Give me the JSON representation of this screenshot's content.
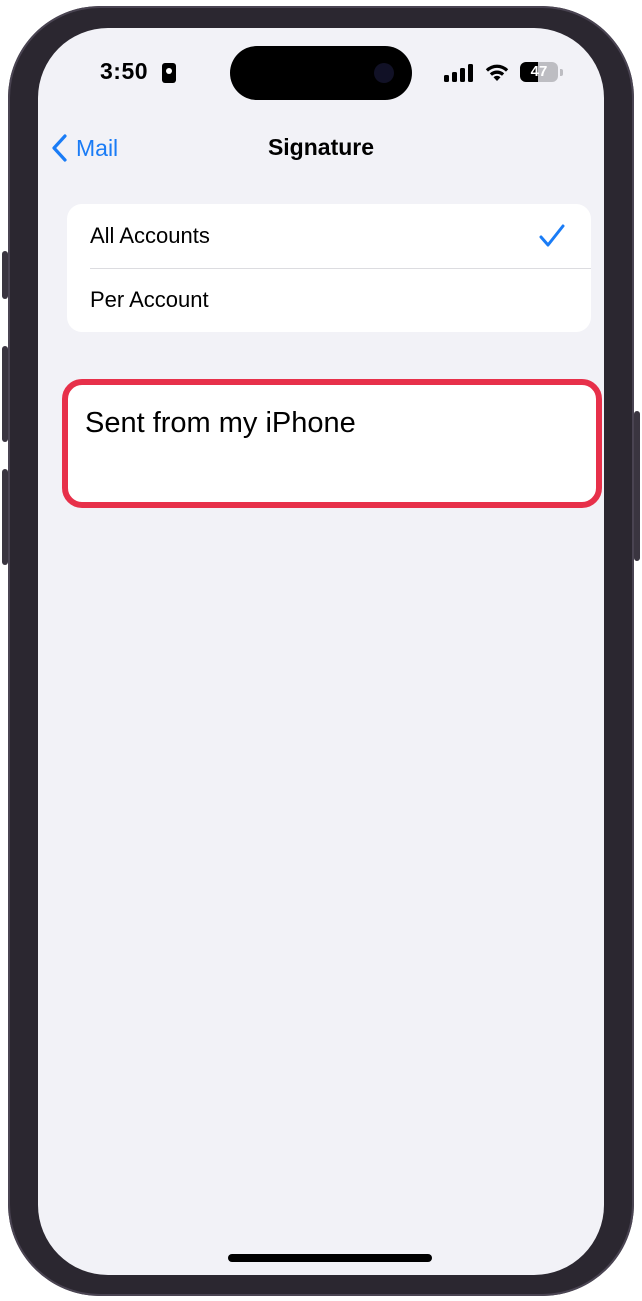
{
  "status_bar": {
    "time": "3:50",
    "battery_level": "47",
    "icons": [
      "id-card-icon",
      "cellular-signal-icon",
      "wifi-icon",
      "battery-icon"
    ]
  },
  "nav": {
    "back_label": "Mail",
    "title": "Signature"
  },
  "options": [
    {
      "label": "All Accounts",
      "selected": true
    },
    {
      "label": "Per Account",
      "selected": false
    }
  ],
  "signature": {
    "text": "Sent from my iPhone"
  },
  "colors": {
    "accent": "#1a7cf6",
    "highlight_border": "#e7304a",
    "background": "#f2f2f7"
  }
}
